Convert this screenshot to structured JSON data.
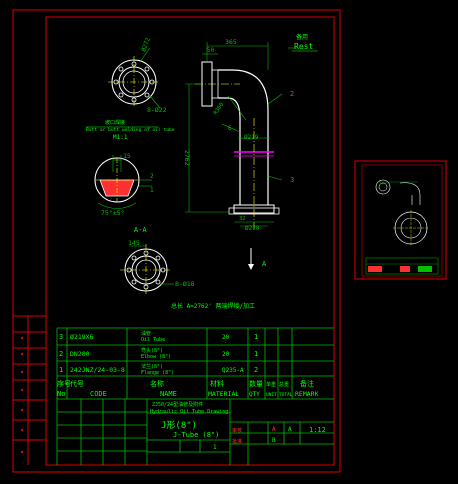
{
  "colors": {
    "background": "#000000",
    "border": "#e00000",
    "outline": "#ffffff",
    "dimension": "#00c000",
    "title_text": "#00ff00",
    "accent_red": "#ff3030",
    "center_line": "#ffff00",
    "highlight": "#ff00ff"
  },
  "drawing": {
    "top_view_dims": {
      "diameter": "Ø272",
      "bolt_holes": "8-Ø22"
    },
    "top_view_note_cn": "坡口焊接",
    "top_view_note_en": "Butt or butt welding of oil tube",
    "top_view_note_scale": "M1:1",
    "section_dims": {
      "w15": "15",
      "angle": "75°±5°",
      "r2": "2",
      "r1": "1"
    },
    "section_label": "A-A",
    "flange_dims": {
      "w145": "145",
      "holes": "8-Ø18"
    },
    "pipe_dims": {
      "d365": "365",
      "d50": "50",
      "r360": "R360",
      "d6": "6",
      "d219": "Ø219",
      "length": "2762",
      "d32": "32",
      "d270": "Ø270"
    },
    "rest_cn": "备用",
    "rest_en": "Rest",
    "callout_2": "2",
    "callout_3": "3",
    "section_mark": "A",
    "length_note": "总长 A=2762'  两端焊接/加工"
  },
  "parts_table": {
    "rows": [
      {
        "no": "3",
        "code": "Ø219X6",
        "name_cn": "油管",
        "name_en": "Oil Tube",
        "material": "20",
        "qty": "1"
      },
      {
        "no": "2",
        "code": "DN200",
        "name_cn": "弯头(8\")",
        "name_en": "Elbow (8\")",
        "material": "20",
        "qty": "1"
      },
      {
        "no": "1",
        "code": "242JNZ/24-03-8",
        "name_cn": "法兰(8\")",
        "name_en": "Flange (8\")",
        "material": "Q235-A",
        "qty": "2"
      }
    ],
    "header_cn": [
      "序号",
      "代号",
      "名称",
      "材料",
      "数量",
      "单重",
      "总重",
      "备注"
    ],
    "header_en": [
      "No",
      "CODE",
      "NAME",
      "MATERIAL",
      "QTY",
      "UNIT",
      "TOTAL",
      "REMARK"
    ]
  },
  "title_block": {
    "project_cn": "ZJ50/24型油管及附件",
    "project_en": "Hydraulic Oil Tube Drawing",
    "part_cn": "J形(8\")",
    "part_en": "J-Tube (8\")",
    "scale": "1:12",
    "sheet": "1",
    "stage": "A",
    "mark_a": "A",
    "mark_b": "B",
    "label_chk": "审核",
    "label_app": "批准"
  },
  "side_panel": {
    "label": "thumbnail"
  }
}
